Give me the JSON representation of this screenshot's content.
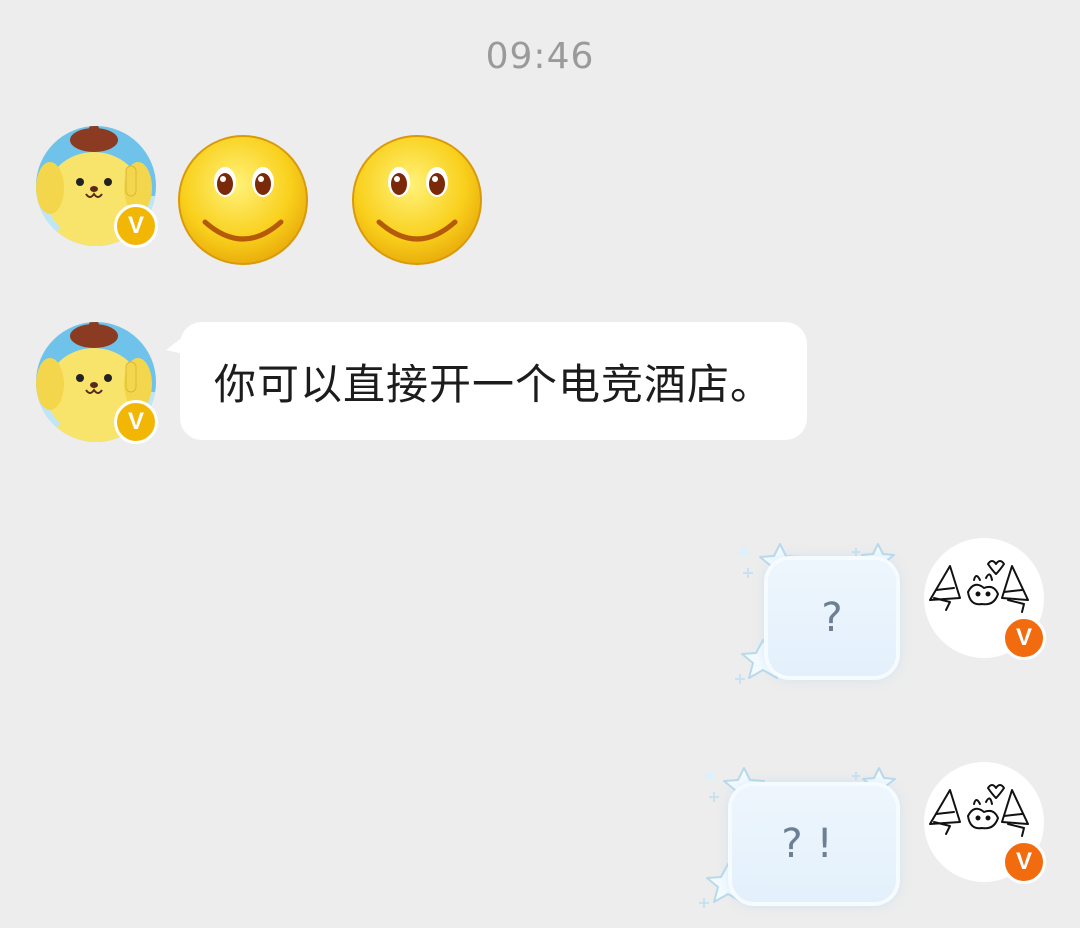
{
  "header": {
    "timestamp": "09:46"
  },
  "messages": [
    {
      "sender": "other",
      "type": "emoji",
      "emoji": [
        "smile-emoji",
        "smile-emoji"
      ]
    },
    {
      "sender": "other",
      "type": "text",
      "text": "你可以直接开一个电竞酒店。"
    },
    {
      "sender": "self",
      "type": "text",
      "text": "?"
    },
    {
      "sender": "self",
      "type": "text",
      "text": "?!"
    }
  ],
  "avatars": {
    "other": {
      "icon": "yellow-dog-avatar-icon",
      "badge": "V",
      "badge_color": "#f2b705"
    },
    "self": {
      "icon": "doodle-bunny-avatar-icon",
      "badge": "V",
      "badge_color": "#f26b0f"
    }
  },
  "colors": {
    "background": "#ededed",
    "bubble_other": "#ffffff",
    "bubble_self": "#e3f0fb"
  }
}
